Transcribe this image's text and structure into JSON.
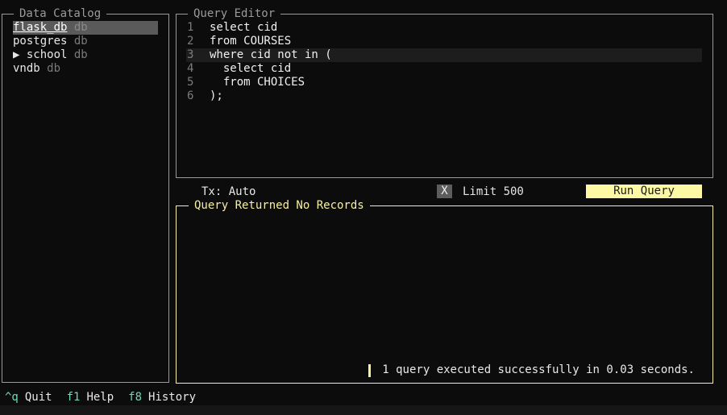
{
  "catalog": {
    "title": "Data Catalog",
    "items": [
      {
        "prefix": "",
        "name": "flask_db",
        "tag": "db",
        "selected": true
      },
      {
        "prefix": "",
        "name": "postgres",
        "tag": "db",
        "selected": false
      },
      {
        "prefix": "▶ ",
        "name": "school",
        "tag": "db",
        "selected": false
      },
      {
        "prefix": "",
        "name": "vndb",
        "tag": "db",
        "selected": false
      }
    ]
  },
  "editor": {
    "title": "Query Editor",
    "lines": [
      {
        "num": "1",
        "text": "select cid"
      },
      {
        "num": "2",
        "text": "from COURSES"
      },
      {
        "num": "3",
        "text": "where cid not in ("
      },
      {
        "num": "4",
        "text": "  select cid"
      },
      {
        "num": "5",
        "text": "  from CHOICES"
      },
      {
        "num": "6",
        "text": ");"
      }
    ],
    "current_line": 3
  },
  "toolbar": {
    "tx_label": "Tx: Auto",
    "limit_checkbox": "X",
    "limit_label": "Limit 500",
    "run_button": "Run Query"
  },
  "results": {
    "title": "Query Returned No Records",
    "status": "1 query executed successfully in 0.03 seconds."
  },
  "footer": {
    "bindings": [
      {
        "key": "^q",
        "label": "Quit"
      },
      {
        "key": "f1",
        "label": "Help"
      },
      {
        "key": "f8",
        "label": "History"
      }
    ]
  },
  "colors": {
    "accent": "#f7f0a0",
    "key_color": "#6fd9b0",
    "selection": "#5a5a5a",
    "border": "#9a9a9a"
  }
}
